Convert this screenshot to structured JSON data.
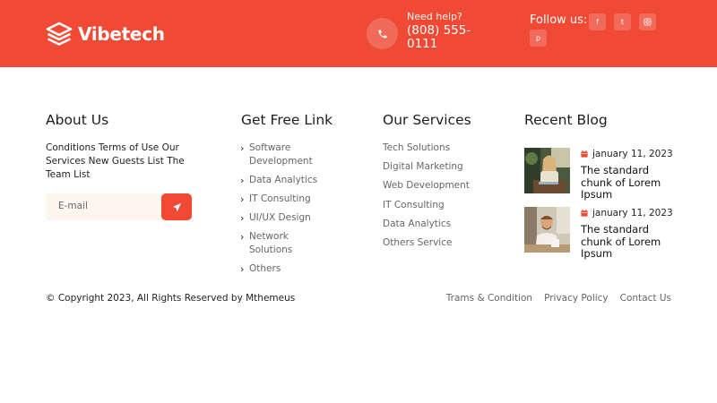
{
  "header": {
    "brand": "Vibetech",
    "help_label": "Need help?",
    "help_phone": "(808) 555-0111",
    "follow_label": "Follow us:",
    "social": [
      {
        "icon": "facebook-icon",
        "glyph": "f"
      },
      {
        "icon": "twitter-icon",
        "glyph": "t"
      },
      {
        "icon": "instagram-icon",
        "glyph": "ig"
      },
      {
        "icon": "pinterest-icon",
        "glyph": "p"
      }
    ],
    "accent": "#f04a35"
  },
  "about": {
    "title": "About Us",
    "text": "Conditions Terms of Use Our Services New Guests List The Team List",
    "email_placeholder": "E-mail"
  },
  "free_links": {
    "title": "Get Free Link",
    "items": [
      "Software Development",
      "Data Analytics",
      "IT Consulting",
      "UI/UX Design",
      "Network Solutions",
      "Others"
    ]
  },
  "services": {
    "title": "Our Services",
    "items": [
      "Tech Solutions",
      "Digital Marketing",
      "Web Development",
      "IT Consulting",
      "Data Analytics",
      "Others Service"
    ]
  },
  "blog": {
    "title": "Recent Blog",
    "posts": [
      {
        "date": "january 11, 2023",
        "title": "The standard chunk of Lorem Ipsum"
      },
      {
        "date": "january 11, 2023",
        "title": "The standard chunk of Lorem Ipsum"
      }
    ]
  },
  "footer": {
    "copyright": "© Copyright 2023, All Rights Reserved by Mthemeus",
    "links": [
      "Trams & Condition",
      "Privacy Policy",
      "Contact Us"
    ]
  }
}
